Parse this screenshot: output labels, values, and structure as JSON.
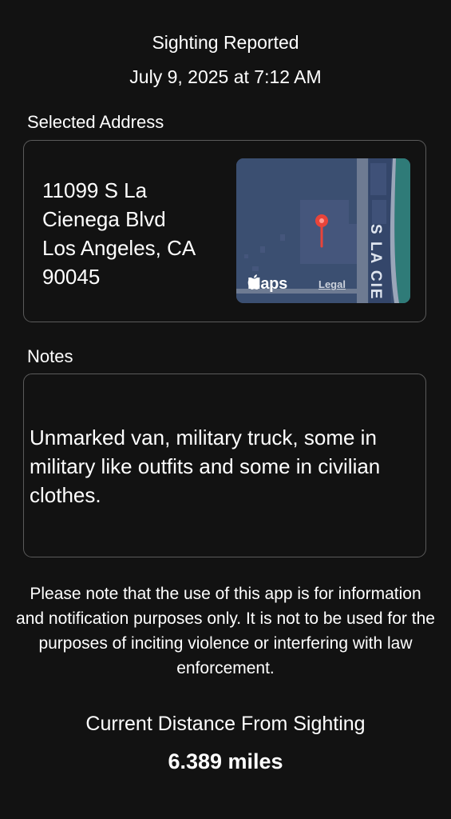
{
  "header": {
    "title": "Sighting Reported",
    "date": "July 9, 2025 at 7:12 AM"
  },
  "address": {
    "label": "Selected Address",
    "lines": [
      "11099 S La",
      "Cienega Blvd",
      "Los Angeles, CA",
      "90045"
    ]
  },
  "map": {
    "brand": "Maps",
    "legal": "Legal",
    "street_label": "S LA CIE",
    "pin_color": "#e8443a",
    "logo_icon": "apple-logo-icon"
  },
  "notes": {
    "label": "Notes",
    "text": "Unmarked van, military truck, some in military like outfits and some in civilian clothes."
  },
  "disclaimer": "Please note that the use of this app is for information and notification purposes only. It is not to be used for the purposes of inciting violence or interfering with law enforcement.",
  "distance": {
    "label": "Current Distance From Sighting",
    "value": "6.389 miles"
  },
  "colors": {
    "background": "#121212",
    "card_border": "#5b5b5b",
    "map_base": "#3b4f71",
    "text": "#ffffff"
  }
}
